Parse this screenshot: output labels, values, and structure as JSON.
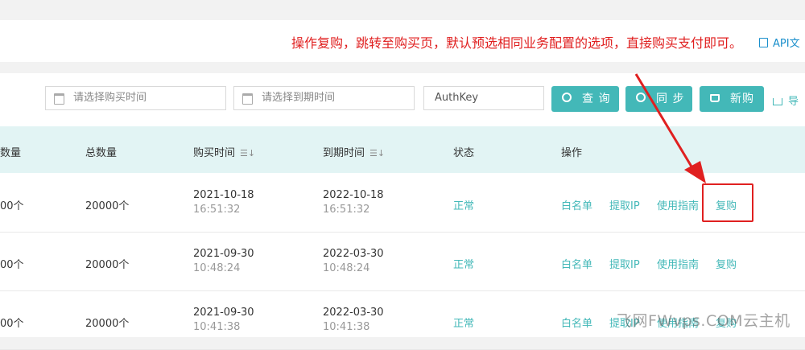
{
  "annotation": "操作复购，跳转至购买页，默认预选相同业务配置的选项，直接购买支付即可。",
  "api_link": "API文",
  "filters": {
    "purchase_time_placeholder": "请选择购买时间",
    "expire_time_placeholder": "请选择到期时间",
    "authkey_placeholder": "AuthKey"
  },
  "buttons": {
    "query": "查 询",
    "sync": "同 步",
    "new_purchase": "新购",
    "export": "导"
  },
  "table": {
    "headers": {
      "remaining": "数量",
      "total": "总数量",
      "purchase_time": "购买时间",
      "expire_time": "到期时间",
      "status": "状态",
      "action": "操作"
    },
    "rows": [
      {
        "remaining": "00个",
        "total": "20000个",
        "purchase_date": "2021-10-18",
        "purchase_clock": "16:51:32",
        "expire_date": "2022-10-18",
        "expire_clock": "16:51:32",
        "status": "正常"
      },
      {
        "remaining": "00个",
        "total": "20000个",
        "purchase_date": "2021-09-30",
        "purchase_clock": "10:48:24",
        "expire_date": "2022-03-30",
        "expire_clock": "10:48:24",
        "status": "正常"
      },
      {
        "remaining": "00个",
        "total": "20000个",
        "purchase_date": "2021-09-30",
        "purchase_clock": "10:41:38",
        "expire_date": "2022-03-30",
        "expire_clock": "10:41:38",
        "status": "正常"
      }
    ],
    "actions": {
      "whitelist": "白名单",
      "extract_ip": "提取IP",
      "guide": "使用指南",
      "rebuy": "复购"
    }
  },
  "watermark": "飞网FWvps.COM云主机",
  "colors": {
    "accent": "#43b8b8",
    "annotation": "#e02020",
    "header_bg": "#e2f4f4"
  }
}
